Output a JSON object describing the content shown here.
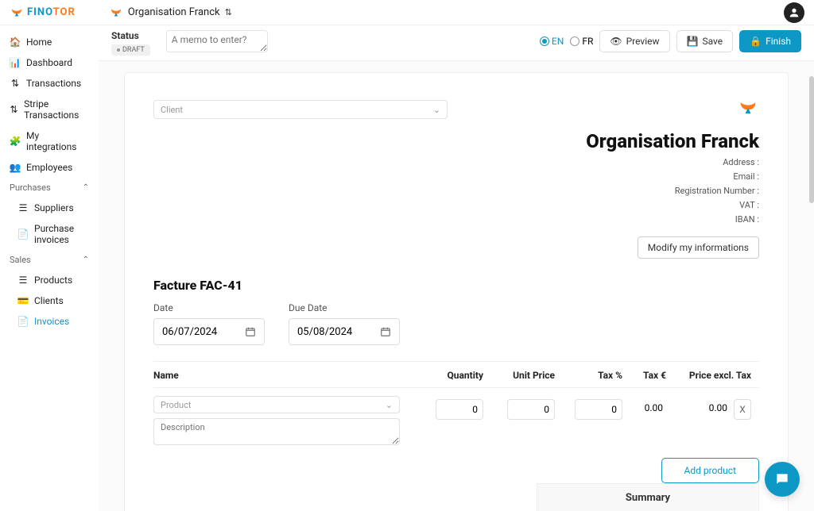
{
  "brand": {
    "part1": "FINO",
    "part2": "TOR"
  },
  "org_switcher": "Organisation Franck",
  "sidebar": {
    "home": "Home",
    "dashboard": "Dashboard",
    "transactions": "Transactions",
    "stripe": "Stripe Transactions",
    "integrations": "My integrations",
    "employees": "Employees",
    "purchases_group": "Purchases",
    "suppliers": "Suppliers",
    "purchase_invoices": "Purchase invoices",
    "sales_group": "Sales",
    "products": "Products",
    "clients": "Clients",
    "invoices": "Invoices"
  },
  "toolbar": {
    "status_label": "Status",
    "status_badge": "DRAFT",
    "memo_placeholder": "A memo to enter?",
    "lang_en": "EN",
    "lang_fr": "FR",
    "preview": "Preview",
    "save": "Save",
    "finish": "Finish"
  },
  "invoice": {
    "client_placeholder": "Client",
    "org_name": "Organisation Franck",
    "address": "Address :",
    "email": "Email :",
    "reg": "Registration Number :",
    "vat": "VAT :",
    "iban": "IBAN :",
    "modify": "Modify my informations",
    "title": "Facture FAC-41",
    "date_label": "Date",
    "due_label": "Due Date",
    "date_val": "06/07/2024",
    "due_val": "05/08/2024",
    "cols": {
      "name": "Name",
      "qty": "Quantity",
      "price": "Unit Price",
      "taxp": "Tax %",
      "taxe": "Tax €",
      "total": "Price excl. Tax"
    },
    "product_placeholder": "Product",
    "desc_placeholder": "Description",
    "line": {
      "qty": "0",
      "price": "0",
      "taxp": "0",
      "taxe": "0.00",
      "total": "0.00"
    },
    "remove": "X",
    "add": "Add product",
    "summary": "Summary"
  }
}
